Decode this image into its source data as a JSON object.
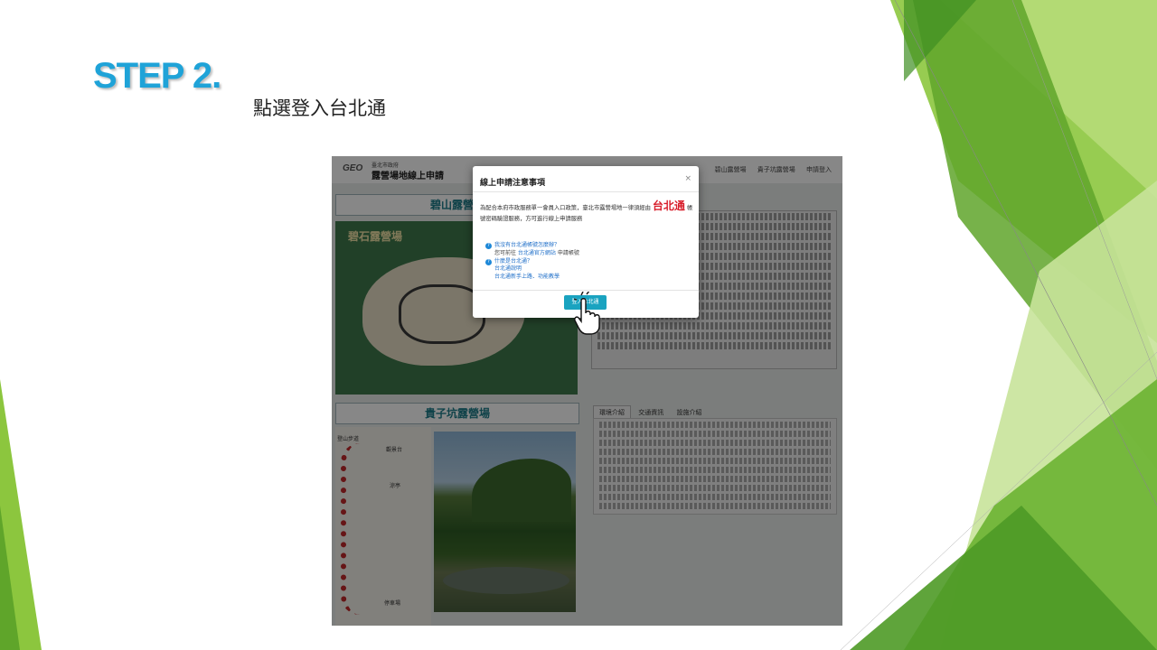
{
  "slide": {
    "step_title": "STEP 2.",
    "description": "點選登入台北通",
    "colors": {
      "step_title": "#1fa3d8",
      "green_dark": "#3f9326",
      "green_light": "#9ccf3a"
    }
  },
  "site": {
    "logo": "GEO",
    "agency": "臺北市政府",
    "name": "露營場地線上申請",
    "nav": [
      "碧山露營場",
      "貴子坑露營場",
      "申請登入"
    ]
  },
  "panels": {
    "bishan_title": "碧山露營場",
    "bishan_map_title": "碧石露營場",
    "guizikeng_title": "貴子坑露營場",
    "map2_labels": [
      "登山步道",
      "觀景台",
      "涼亭",
      "停車場"
    ]
  },
  "tabs": [
    "環境介紹",
    "交通資訊",
    "設施介紹"
  ],
  "modal": {
    "title": "線上申請注意事項",
    "close": "×",
    "body_pre": "為配合本府市政服務單一會員入口政策，臺北市露營場地一律須經由",
    "body_highlight": "台北通",
    "body_post": "帳號密碼驗證服務，方可進行線上申請服務",
    "faq": [
      {
        "question": "我沒有台北通帳號怎麼辦？",
        "answer_pre": "您可前往 ",
        "answer_link": "台北通官方網站",
        "answer_post": " 申請帳號"
      },
      {
        "question": "什麼是台北通？",
        "links": [
          "台北通說明",
          "台北通新手上路．功能教學"
        ]
      }
    ],
    "button": "登入台北通"
  }
}
